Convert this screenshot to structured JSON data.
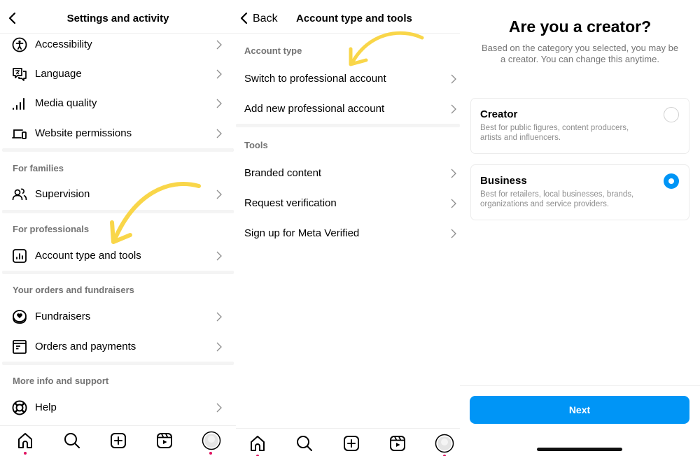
{
  "panel1": {
    "title": "Settings and activity",
    "items_top": [
      {
        "label": "Accessibility",
        "icon": "accessibility-icon"
      },
      {
        "label": "Language",
        "icon": "language-icon"
      },
      {
        "label": "Media quality",
        "icon": "signal-bars-icon"
      },
      {
        "label": "Website permissions",
        "icon": "devices-icon"
      }
    ],
    "sections": [
      {
        "title": "For families",
        "items": [
          {
            "label": "Supervision",
            "icon": "supervision-icon"
          }
        ]
      },
      {
        "title": "For professionals",
        "items": [
          {
            "label": "Account type and tools",
            "icon": "insights-icon"
          }
        ]
      },
      {
        "title": "Your orders and fundraisers",
        "items": [
          {
            "label": "Fundraisers",
            "icon": "fundraiser-icon"
          },
          {
            "label": "Orders and payments",
            "icon": "orders-icon"
          }
        ]
      },
      {
        "title": "More info and support",
        "items": [
          {
            "label": "Help",
            "icon": "help-lifebuoy-icon"
          }
        ]
      }
    ]
  },
  "panel2": {
    "back_label": "Back",
    "title": "Account type and tools",
    "sections": [
      {
        "title": "Account type",
        "items": [
          "Switch to professional account",
          "Add new professional account"
        ]
      },
      {
        "title": "Tools",
        "items": [
          "Branded content",
          "Request verification",
          "Sign up for Meta Verified"
        ]
      }
    ]
  },
  "tabbar": {
    "tabs": [
      "home",
      "search",
      "create",
      "reels",
      "profile"
    ],
    "notification_color": "#e0115f"
  },
  "panel3": {
    "title": "Are you a creator?",
    "subtitle": "Based on the category you selected, you may be a creator. You can change this anytime.",
    "options": [
      {
        "title": "Creator",
        "description": "Best for public figures, content producers, artists and influencers.",
        "selected": false
      },
      {
        "title": "Business",
        "description": "Best for retailers, local businesses, brands, organizations and service providers.",
        "selected": true
      }
    ],
    "next_label": "Next",
    "accent_color": "#0095f6"
  },
  "annotation_color": "#f9d649"
}
